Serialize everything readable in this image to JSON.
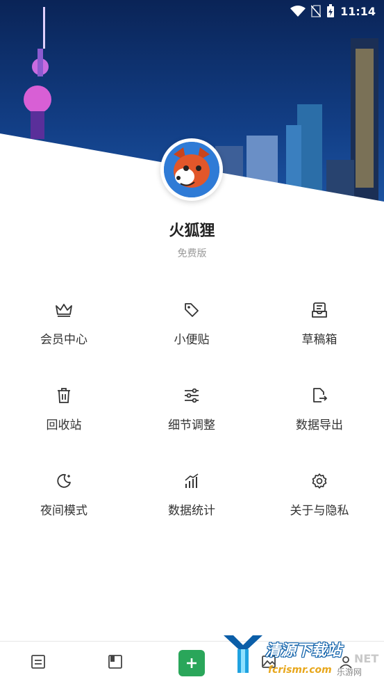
{
  "status_bar": {
    "time": "11:14",
    "icons": [
      "wifi-icon",
      "no-sim-icon",
      "battery-charging-icon"
    ]
  },
  "profile": {
    "name": "火狐狸",
    "plan": "免费版"
  },
  "menu": [
    {
      "label": "会员中心",
      "icon": "crown-icon"
    },
    {
      "label": "小便贴",
      "icon": "tag-icon"
    },
    {
      "label": "草稿箱",
      "icon": "drafts-tray-icon"
    },
    {
      "label": "回收站",
      "icon": "trash-icon"
    },
    {
      "label": "细节调整",
      "icon": "sliders-icon"
    },
    {
      "label": "数据导出",
      "icon": "file-export-icon"
    },
    {
      "label": "夜间模式",
      "icon": "moon-icon"
    },
    {
      "label": "数据统计",
      "icon": "bar-chart-icon"
    },
    {
      "label": "关于与隐私",
      "icon": "gear-icon"
    }
  ],
  "tabbar": [
    "notes-tab",
    "notebook-tab",
    "add-button",
    "gallery-tab",
    "profile-tab"
  ],
  "watermark": {
    "brand": "清源下载站",
    "net": "NET",
    "site": "fcrismr.com",
    "site2": "乐游网"
  },
  "colors": {
    "accent": "#2aa65a",
    "header_sky": "#0c2f6e",
    "text": "#333333",
    "muted": "#9a9a9a"
  }
}
